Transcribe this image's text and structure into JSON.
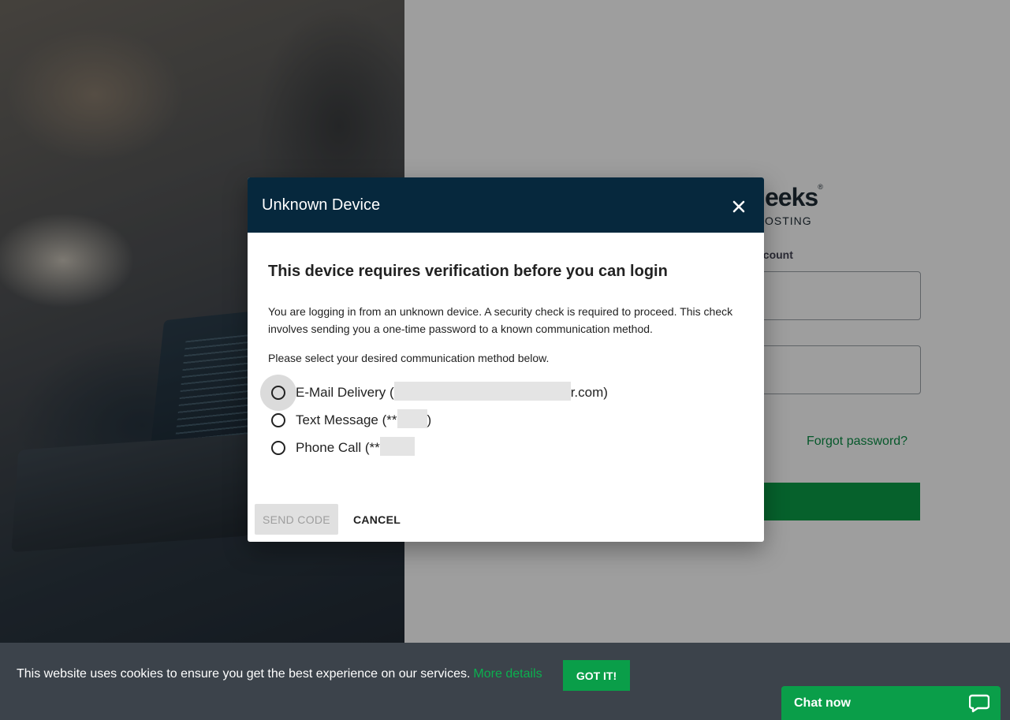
{
  "background": {
    "brand_name": "eeks",
    "brand_mark": "®",
    "brand_sub": "OSTING",
    "account_label": "ccount",
    "forgot_password": "Forgot password?"
  },
  "dialog": {
    "title": "Unknown Device",
    "heading": "This device requires verification before you can login",
    "intro": "You are logging in from an unknown device. A security check is required to proceed. This check involves sending you a one-time password to a known communication method.",
    "instruction": "Please select your desired communication method below.",
    "options": [
      {
        "prefix": "E-Mail Delivery (",
        "suffix": "r.com)"
      },
      {
        "prefix": "Text Message (**",
        "suffix": ")"
      },
      {
        "prefix": "Phone Call (**",
        "suffix": ""
      }
    ],
    "send_code": "SEND CODE",
    "cancel": "CANCEL"
  },
  "cookie": {
    "message": "This website uses cookies to ensure you get the best experience on our services.",
    "more_details": "More details",
    "got_it": "GOT IT!"
  },
  "chat": {
    "label": "Chat now"
  },
  "colors": {
    "dialog_header": "#06283d",
    "accent_green": "#0a9e49",
    "cookie_bar": "#3c434b"
  },
  "icons": {
    "close": "close-icon",
    "chat": "chat-bubble-icon"
  }
}
